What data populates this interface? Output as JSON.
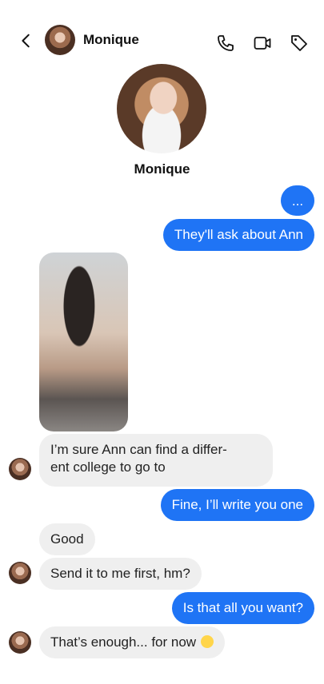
{
  "header": {
    "name": "Monique",
    "icons": [
      "back-arrow",
      "phone",
      "video",
      "tag"
    ]
  },
  "profile": {
    "name": "Monique"
  },
  "messages": [
    {
      "from": "me",
      "text": "..."
    },
    {
      "from": "me",
      "text": "They'll ask about Ann"
    },
    {
      "from": "them",
      "type": "photo"
    },
    {
      "from": "them",
      "line1": "I’m sure Ann can find a differ-",
      "line2": "ent college to go to"
    },
    {
      "from": "me",
      "text": "Fine, I’ll write you one"
    },
    {
      "from": "them",
      "text": "Good"
    },
    {
      "from": "them",
      "text": "Send it to me first, hm?"
    },
    {
      "from": "me",
      "text": "Is that all you want?"
    },
    {
      "from": "them",
      "text": "That’s enough... for now"
    }
  ],
  "colors": {
    "outgoing": "#1f74f5",
    "incoming": "#efefef"
  }
}
